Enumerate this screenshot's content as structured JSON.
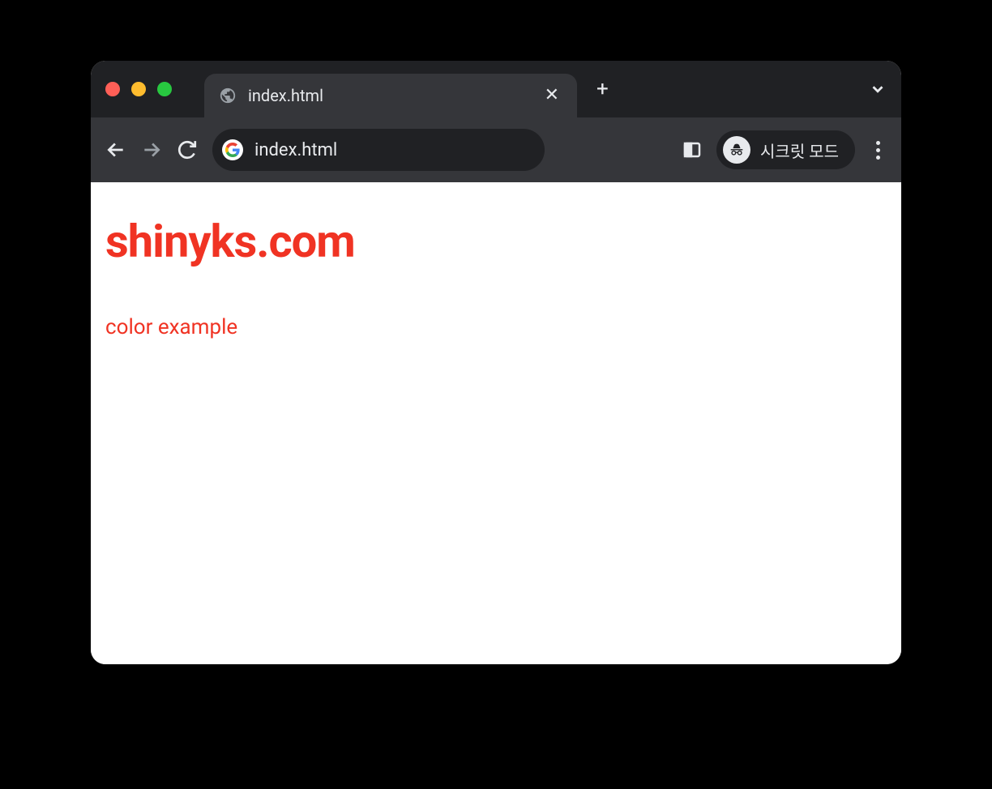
{
  "window": {
    "tab_title": "index.html",
    "address": "index.html",
    "incognito_label": "시크릿 모드"
  },
  "page": {
    "heading": "shinyks.com",
    "body_text": "color example"
  },
  "colors": {
    "accent": "#f03323",
    "chrome_dark": "#202124",
    "chrome_tab": "#35363a"
  }
}
